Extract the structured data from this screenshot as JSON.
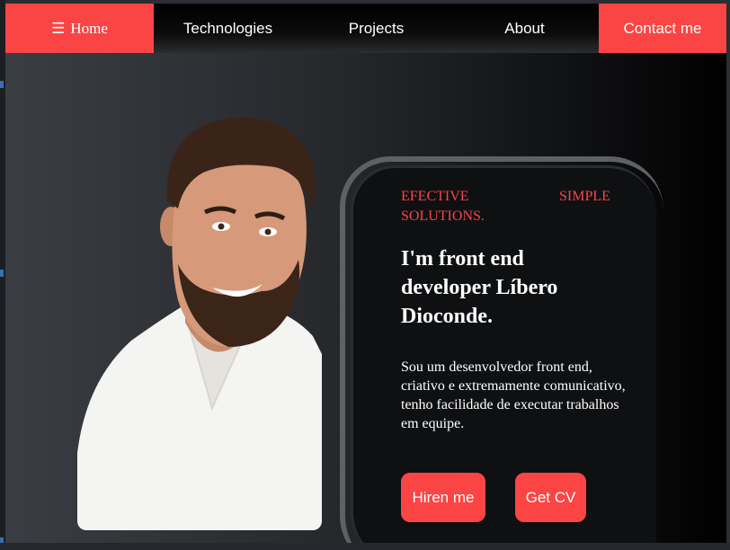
{
  "nav": {
    "home_icon": "☰",
    "home_label": "Home",
    "links": [
      "Technologies",
      "Projects",
      "About"
    ],
    "contact_label": "Contact me"
  },
  "hero": {
    "tagline_left": "EFECTIVE\nSOLUTIONS.",
    "tagline_right": "SIMPLE",
    "headline": "I'm front end developer Líbero Dioconde.",
    "bio": "Sou um desenvolvedor front end, criativo e extremamente comunicativo, tenho facilidade de executar trabalhos em equipe.",
    "primary_button": "Hiren me",
    "secondary_button": "Get CV"
  },
  "colors": {
    "accent": "#fb4444",
    "nav_bg": "#000000",
    "text": "#ffffff"
  },
  "icons": {
    "menu": "hamburger-icon"
  }
}
